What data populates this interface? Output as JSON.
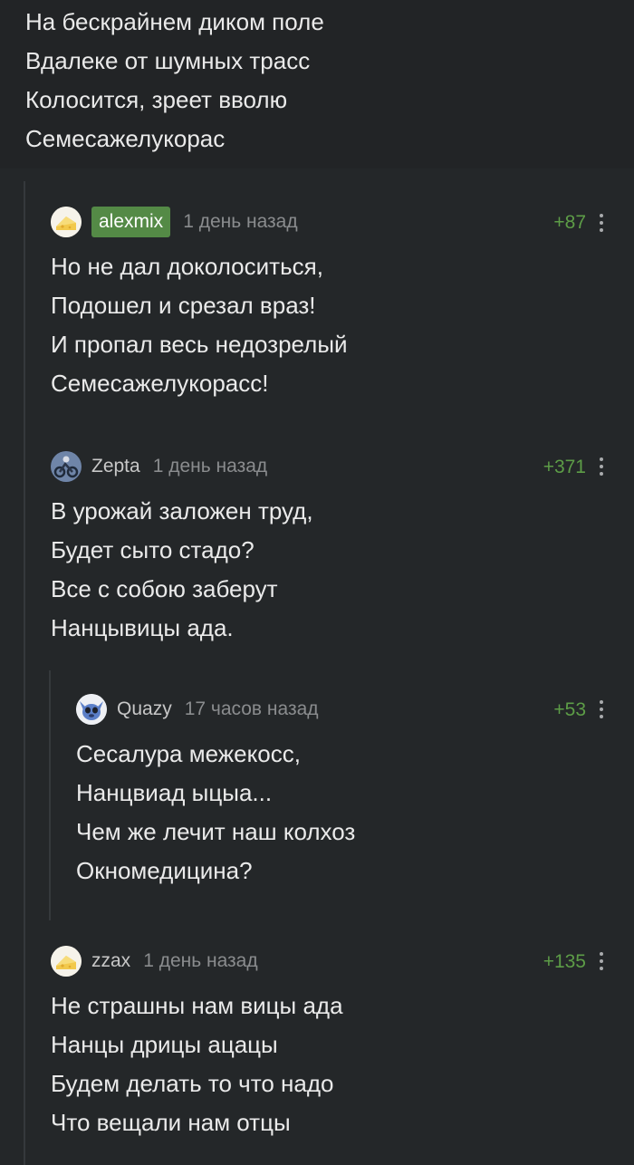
{
  "top_comment": {
    "lines": [
      "На бескрайнем диком поле",
      "Вдалеке от шумных трасс",
      "Колосится, зреет вволю",
      "Семесажелукорас"
    ]
  },
  "comments": [
    {
      "username": "alexmix",
      "time": "1 день назад",
      "rating": "+87",
      "avatar_icon": "cheese-avatar-icon",
      "lines": [
        "Но не дал доколоситься,",
        "Подошел и срезал враз!",
        "И пропал весь недозрелый",
        "Семесажелукорасс!"
      ]
    },
    {
      "username": "Zepta",
      "time": "1 день назад",
      "rating": "+371",
      "avatar_icon": "motorcycle-avatar-icon",
      "lines": [
        "В урожай заложен труд,",
        "Будет сыто стадо?",
        "Все с собою заберут",
        "Нанцывицы ада."
      ]
    },
    {
      "username": "Quazy",
      "time": "17 часов назад",
      "rating": "+53",
      "avatar_icon": "stitch-avatar-icon",
      "lines": [
        "Сесалура межекосс,",
        "Нанцвиад ыцыа...",
        "Чем же лечит наш колхоз",
        "Окномедицина?"
      ]
    },
    {
      "username": "zzax",
      "time": "1 день назад",
      "rating": "+135",
      "avatar_icon": "cheese-avatar-icon",
      "lines": [
        "Не страшны нам вицы ада",
        "Нанцы дрицы ацацы",
        "Будем делать то что надо",
        "Что вещали нам отцы"
      ]
    }
  ],
  "colors": {
    "background": "#242729",
    "rating": "#5d9d47",
    "author_badge": "#548a46"
  }
}
